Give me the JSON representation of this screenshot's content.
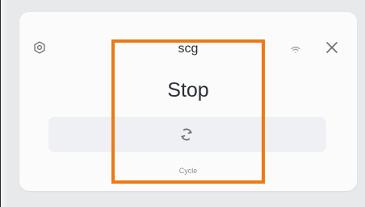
{
  "device": {
    "name": "scg",
    "status": "Stop"
  },
  "action": {
    "label": "Cycle",
    "icon": "cycle-icon"
  },
  "header": {
    "settings_icon": "gear-icon",
    "wifi_icon": "wifi-icon",
    "close_icon": "close-icon"
  },
  "colors": {
    "highlight": "#ec7a14",
    "card": "#fbfbfc",
    "action_bg": "#eef0f4",
    "text": "#2b2f36"
  }
}
